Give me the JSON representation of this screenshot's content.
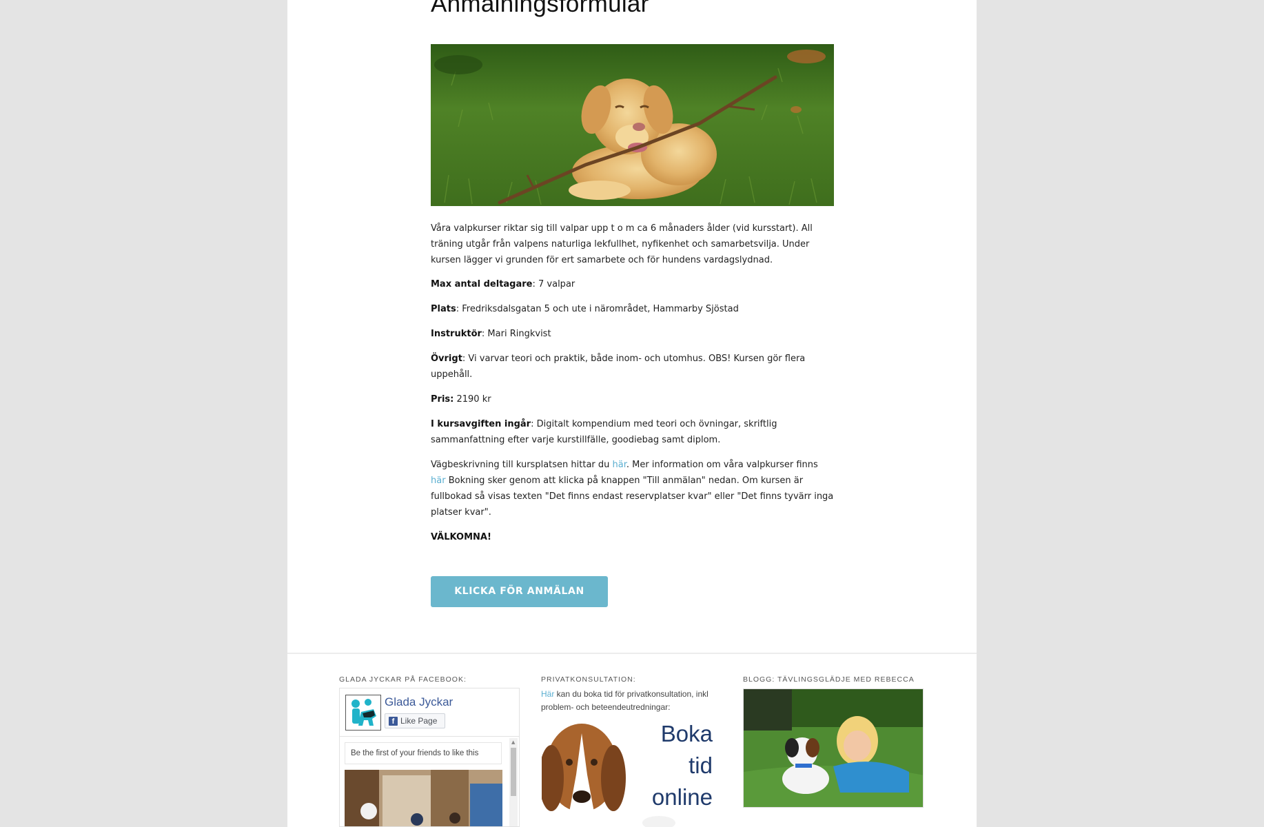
{
  "page": {
    "heading": "Anmälningsformulär"
  },
  "intro": {
    "text": "Våra valpkurser riktar sig till valpar upp t o m ca 6 månaders ålder (vid kursstart). All träning utgår från valpens naturliga lekfullhet, nyfikenhet och samarbetsvilja. Under kursen lägger vi grunden för ert samarbete och för hundens vardagslydnad."
  },
  "details": {
    "max_label": "Max antal deltagare",
    "max_value": ": 7 valpar",
    "plats_label": "Plats",
    "plats_value": ": Fredriksdalsgatan 5 och ute i närområdet, Hammarby Sjöstad",
    "instruktor_label": "Instruktör",
    "instruktor_value": ": Mari Ringkvist",
    "ovrigt_label": "Övrigt",
    "ovrigt_value": ": Vi varvar teori och praktik, både inom- och utomhus. OBS! Kursen gör flera uppehåll.",
    "pris_label": "Pris:",
    "pris_value": " 2190 kr",
    "ingar_label": "I kursavgiften ingår",
    "ingar_value": ": Digitalt kompendium med teori och övningar, skriftlig sammanfattning efter varje kurstillfälle, goodiebag samt diplom."
  },
  "directions": {
    "part1": "Vägbeskrivning till kursplatsen hittar du ",
    "link1": "här",
    "part2": ". Mer information om våra valpkurser finns ",
    "link2": "här",
    "part3": " Bokning sker genom att klicka på knappen \"Till anmälan\" nedan. Om kursen är fullbokad så visas texten \"Det finns endast reservplatser kvar\" eller \"Det finns tyvärr inga platser kvar\"."
  },
  "welcome": "VÄLKOMNA!",
  "cta": {
    "label": "KLICKA FÖR ANMÄLAN",
    "color": "#6bb7cd"
  },
  "footer": {
    "facebook": {
      "title": "GLADA JYCKAR PÅ FACEBOOK:",
      "page_name": "Glada Jyckar",
      "like_label": "Like Page",
      "friends_text": "Be the first of your friends to like this"
    },
    "privat": {
      "title": "PRIVATKONSULTATION:",
      "link": "Här",
      "text": " kan du boka tid för privatkonsultation, inkl problem- och beteendeutredningar:",
      "image_lines": [
        "Boka",
        "tid",
        "online"
      ]
    },
    "blog": {
      "title": "BLOGG: TÄVLINGSGLÄDJE MED REBECCA"
    }
  },
  "colors": {
    "link": "#5aaed0",
    "background": "#e4e4e4",
    "facebook_blue": "#3b5998"
  }
}
